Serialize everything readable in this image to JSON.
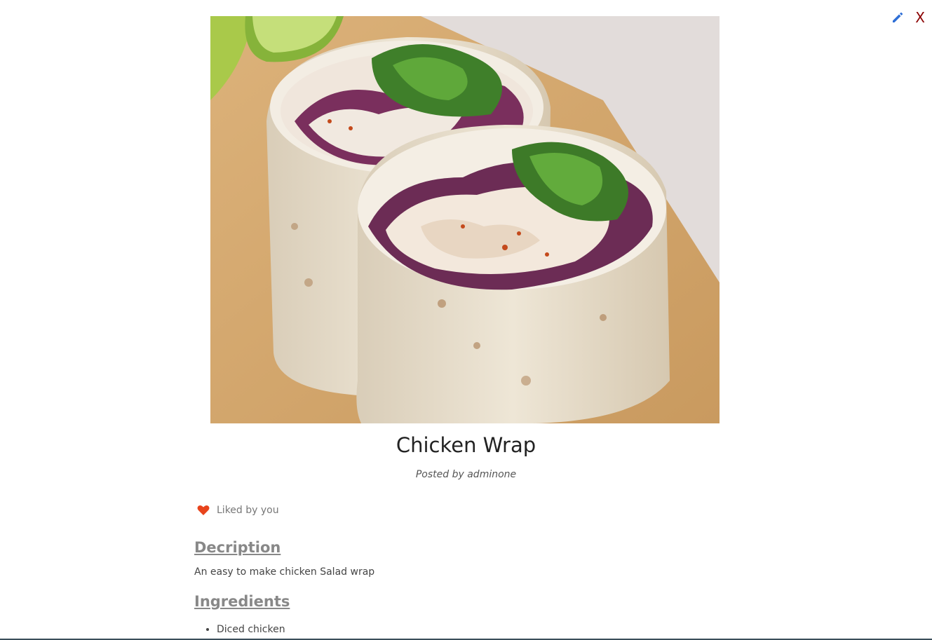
{
  "header": {
    "edit_icon": "pencil-icon",
    "close_label": "X"
  },
  "recipe": {
    "image_alt": "Chicken Wrap photo",
    "title": "Chicken Wrap",
    "posted_by": "Posted by adminone",
    "like": {
      "icon": "heart-icon",
      "label": "Liked by you",
      "color": "#e8441c"
    },
    "description_heading": "Decription",
    "description": "An easy to make chicken Salad wrap",
    "ingredients_heading": "Ingredients",
    "ingredients": [
      "Diced chicken"
    ]
  },
  "colors": {
    "edit_icon": "#2f6fd6",
    "close": "#8b0000",
    "heading": "#888888"
  }
}
